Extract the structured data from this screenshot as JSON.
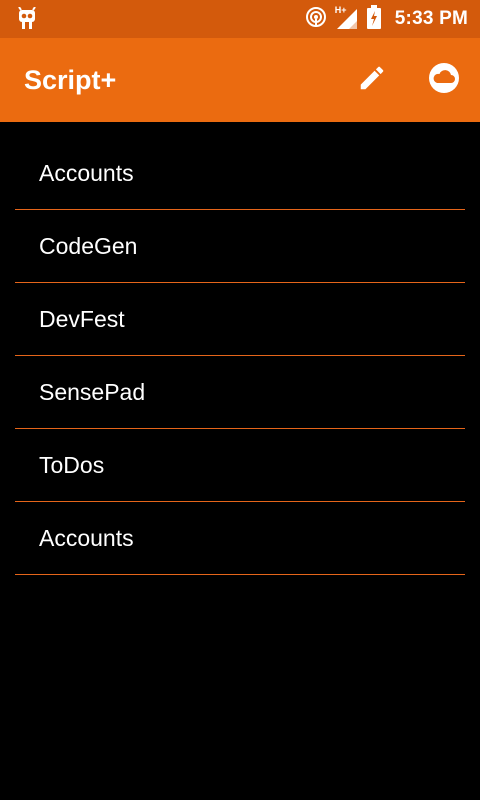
{
  "status_bar": {
    "time": "5:33 PM",
    "network_label": "H+",
    "icons": [
      "debug-bug-icon",
      "hotspot-icon",
      "signal-icon",
      "battery-charging-icon"
    ]
  },
  "app_bar": {
    "title": "Script+",
    "actions": [
      {
        "icon": "edit-pencil-icon"
      },
      {
        "icon": "cloud-icon"
      }
    ]
  },
  "script_list": {
    "items": [
      {
        "label": "Accounts"
      },
      {
        "label": "CodeGen"
      },
      {
        "label": "DevFest"
      },
      {
        "label": "SensePad"
      },
      {
        "label": "ToDos"
      },
      {
        "label": "Accounts"
      }
    ]
  },
  "colors": {
    "status_bar": "#d35a0c",
    "app_bar": "#eb6b10",
    "divider": "#e5651a",
    "background": "#000000",
    "text": "#ffffff"
  }
}
